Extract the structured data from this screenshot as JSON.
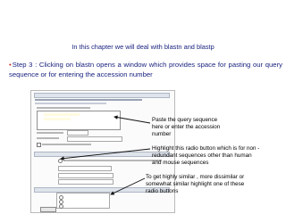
{
  "heading": "In this chapter we will deal with blastn and blastp",
  "step": {
    "bullet": "•",
    "text": "Step 3 : Clicking on blastn opens a window which provides space for pasting our query sequence or for entering the accession number"
  },
  "annotations": {
    "query": [
      "Paste the query sequence",
      "here or enter the accession",
      "number"
    ],
    "radio": [
      "Highlight this radio button which is for non -",
      "redundant sequences other than human",
      "and mouse sequences"
    ],
    "similar": [
      "To get highly similar , more dissimilar or",
      "somewhat similar highlight one of these",
      "radio buttons"
    ]
  },
  "colors": {
    "heading": "#1a237e",
    "bullet": "#c62828",
    "arrow": "#111111"
  }
}
